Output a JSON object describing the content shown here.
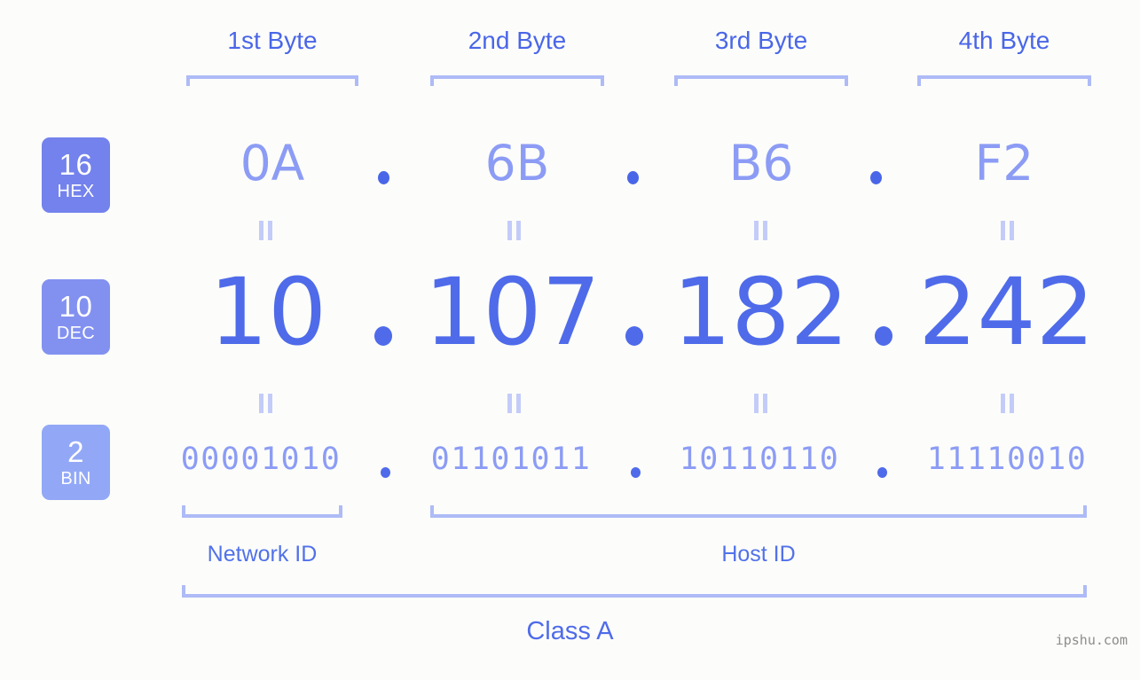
{
  "background": "#fcfdfa",
  "accent": {
    "strong": "#4a66e8",
    "mid": "#5271ea",
    "light": "#8c9cf5",
    "pale": "#aebbf7",
    "faint": "#c3ccf9"
  },
  "byte_headers": [
    {
      "label": "1st Byte"
    },
    {
      "label": "2nd Byte"
    },
    {
      "label": "3rd Byte"
    },
    {
      "label": "4th Byte"
    }
  ],
  "bases": [
    {
      "id": "hex",
      "number": "16",
      "name": "HEX",
      "color": "#7382ec"
    },
    {
      "id": "dec",
      "number": "10",
      "name": "DEC",
      "color": "#8291f0"
    },
    {
      "id": "bin",
      "number": "2",
      "name": "BIN",
      "color": "#92a8f7"
    }
  ],
  "rows": {
    "hex": {
      "octets": [
        "0A",
        "6B",
        "B6",
        "F2"
      ],
      "separator": "."
    },
    "dec": {
      "octets": [
        "10",
        "107",
        "182",
        "242"
      ],
      "separator": "."
    },
    "bin": {
      "octets": [
        "00001010",
        "01101011",
        "10110110",
        "11110010"
      ],
      "separator": "."
    }
  },
  "equals_symbol": "=",
  "segments": [
    {
      "label": "Network ID"
    },
    {
      "label": "Host ID"
    }
  ],
  "class": {
    "label": "Class A"
  },
  "watermark": {
    "text": "ipshu.com"
  }
}
